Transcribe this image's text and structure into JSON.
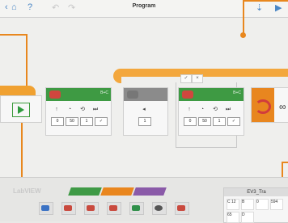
{
  "topbar": {
    "title": "Program",
    "help": "?"
  },
  "blocks": {
    "block1": {
      "values": [
        "0",
        "50",
        "1"
      ],
      "port": "B+C"
    },
    "block2": {
      "values": [
        "1"
      ]
    },
    "block3": {
      "values": [
        "0",
        "50",
        "1"
      ],
      "port": "B+C"
    }
  },
  "loop": {
    "check": "✓",
    "cross": "×",
    "count": "∞"
  },
  "palette": {
    "label": "LabVIEW"
  },
  "project": {
    "name": "EV3_Tra",
    "items": [
      "C 12",
      "B",
      "0",
      "594",
      "65",
      "D"
    ]
  }
}
